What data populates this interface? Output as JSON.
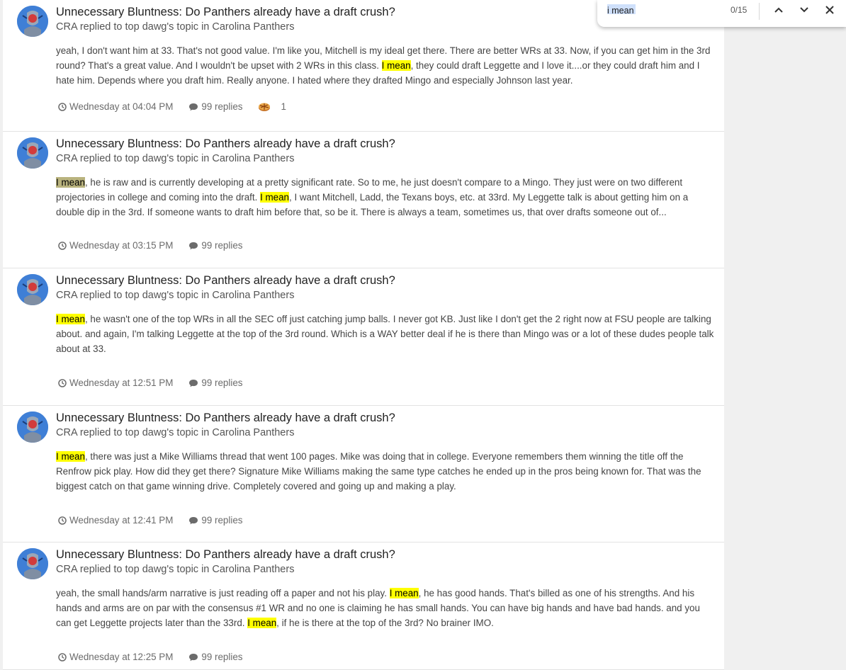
{
  "find_bar": {
    "query": "i mean",
    "match_count": "0/15",
    "icons": {
      "prev": "chevron-up-icon",
      "next": "chevron-down-icon",
      "close": "close-icon"
    }
  },
  "colors": {
    "highlight": "#ffff00",
    "current_highlight": "#b9b37e",
    "avatar": "#3f7fd6"
  },
  "posts": [
    {
      "title": "Unnecessary Bluntness: Do Panthers already have a draft crush?",
      "meta": "CRA replied to top dawg's topic in Carolina Panthers",
      "body": [
        {
          "t": "yeah, I don't want him at 33. That's not good value. I'm like you, Mitchell is my ideal get there. There are better WRs at 33. Now, if you can get him in the 3rd round? That's a great value. And I wouldn't be upset with 2 WRs in this class. "
        },
        {
          "t": "I mean",
          "h": true
        },
        {
          "t": ", they could draft Leggette and I love it....or they could draft him and I hate him. Depends where you draft him. Really anyone. I hated where they drafted Mingo and especially Johnson last year."
        }
      ],
      "time": "Wednesday at 04:04 PM",
      "replies": "99 replies",
      "reaction_count": "1"
    },
    {
      "title": "Unnecessary Bluntness: Do Panthers already have a draft crush?",
      "meta": "CRA replied to top dawg's topic in Carolina Panthers",
      "body": [
        {
          "t": "I mean",
          "h": true,
          "current": true
        },
        {
          "t": ", he is raw and is currently developing at a pretty significant rate. So to me, he just doesn't compare to a Mingo. They just were on two different projectories in college and coming into the draft. "
        },
        {
          "t": "I mean",
          "h": true
        },
        {
          "t": ", I want Mitchell, Ladd, the Texans boys, etc. at 33rd. My Leggette talk is about getting him on a double dip in the 3rd. If someone wants to draft him before that, so be it. There is always a team, sometimes us, that over drafts someone out of..."
        }
      ],
      "time": "Wednesday at 03:15 PM",
      "replies": "99 replies"
    },
    {
      "title": "Unnecessary Bluntness: Do Panthers already have a draft crush?",
      "meta": "CRA replied to top dawg's topic in Carolina Panthers",
      "body": [
        {
          "t": "I mean",
          "h": true
        },
        {
          "t": ", he wasn't one of the top WRs in all the SEC off just catching jump balls. I never got KB. Just like I don't get the 2 right now at FSU people are talking about. and again, I'm talking Leggette at the top of the 3rd round. Which is a WAY better deal if he is there than Mingo was or a lot of these dudes people talk about at 33."
        }
      ],
      "time": "Wednesday at 12:51 PM",
      "replies": "99 replies"
    },
    {
      "title": "Unnecessary Bluntness: Do Panthers already have a draft crush?",
      "meta": "CRA replied to top dawg's topic in Carolina Panthers",
      "body": [
        {
          "t": "I mean",
          "h": true
        },
        {
          "t": ", there was just a Mike Williams thread that went 100 pages. Mike was doing that in college. Everyone remembers them winning the title off the Renfrow pick play. How did they get there? Signature Mike Williams making the same type catches he ended up in the pros being known for. That was the biggest catch on that game winning drive. Completely covered and going up and making a play."
        }
      ],
      "time": "Wednesday at 12:41 PM",
      "replies": "99 replies"
    },
    {
      "title": "Unnecessary Bluntness: Do Panthers already have a draft crush?",
      "meta": "CRA replied to top dawg's topic in Carolina Panthers",
      "body": [
        {
          "t": "yeah, the small hands/arm narrative is just reading off a paper and not his play. "
        },
        {
          "t": "I mean",
          "h": true
        },
        {
          "t": ", he has good hands. That's billed as one of his strengths. And his hands and arms are on par with the consensus #1 WR and no one is claiming he has small hands. You can have big hands and have bad hands. and you can get Leggette projects later than the 33rd. "
        },
        {
          "t": "I mean",
          "h": true
        },
        {
          "t": ", if he is there at the top of the 3rd? No brainer IMO."
        }
      ],
      "time": "Wednesday at 12:25 PM",
      "replies": "99 replies"
    }
  ]
}
